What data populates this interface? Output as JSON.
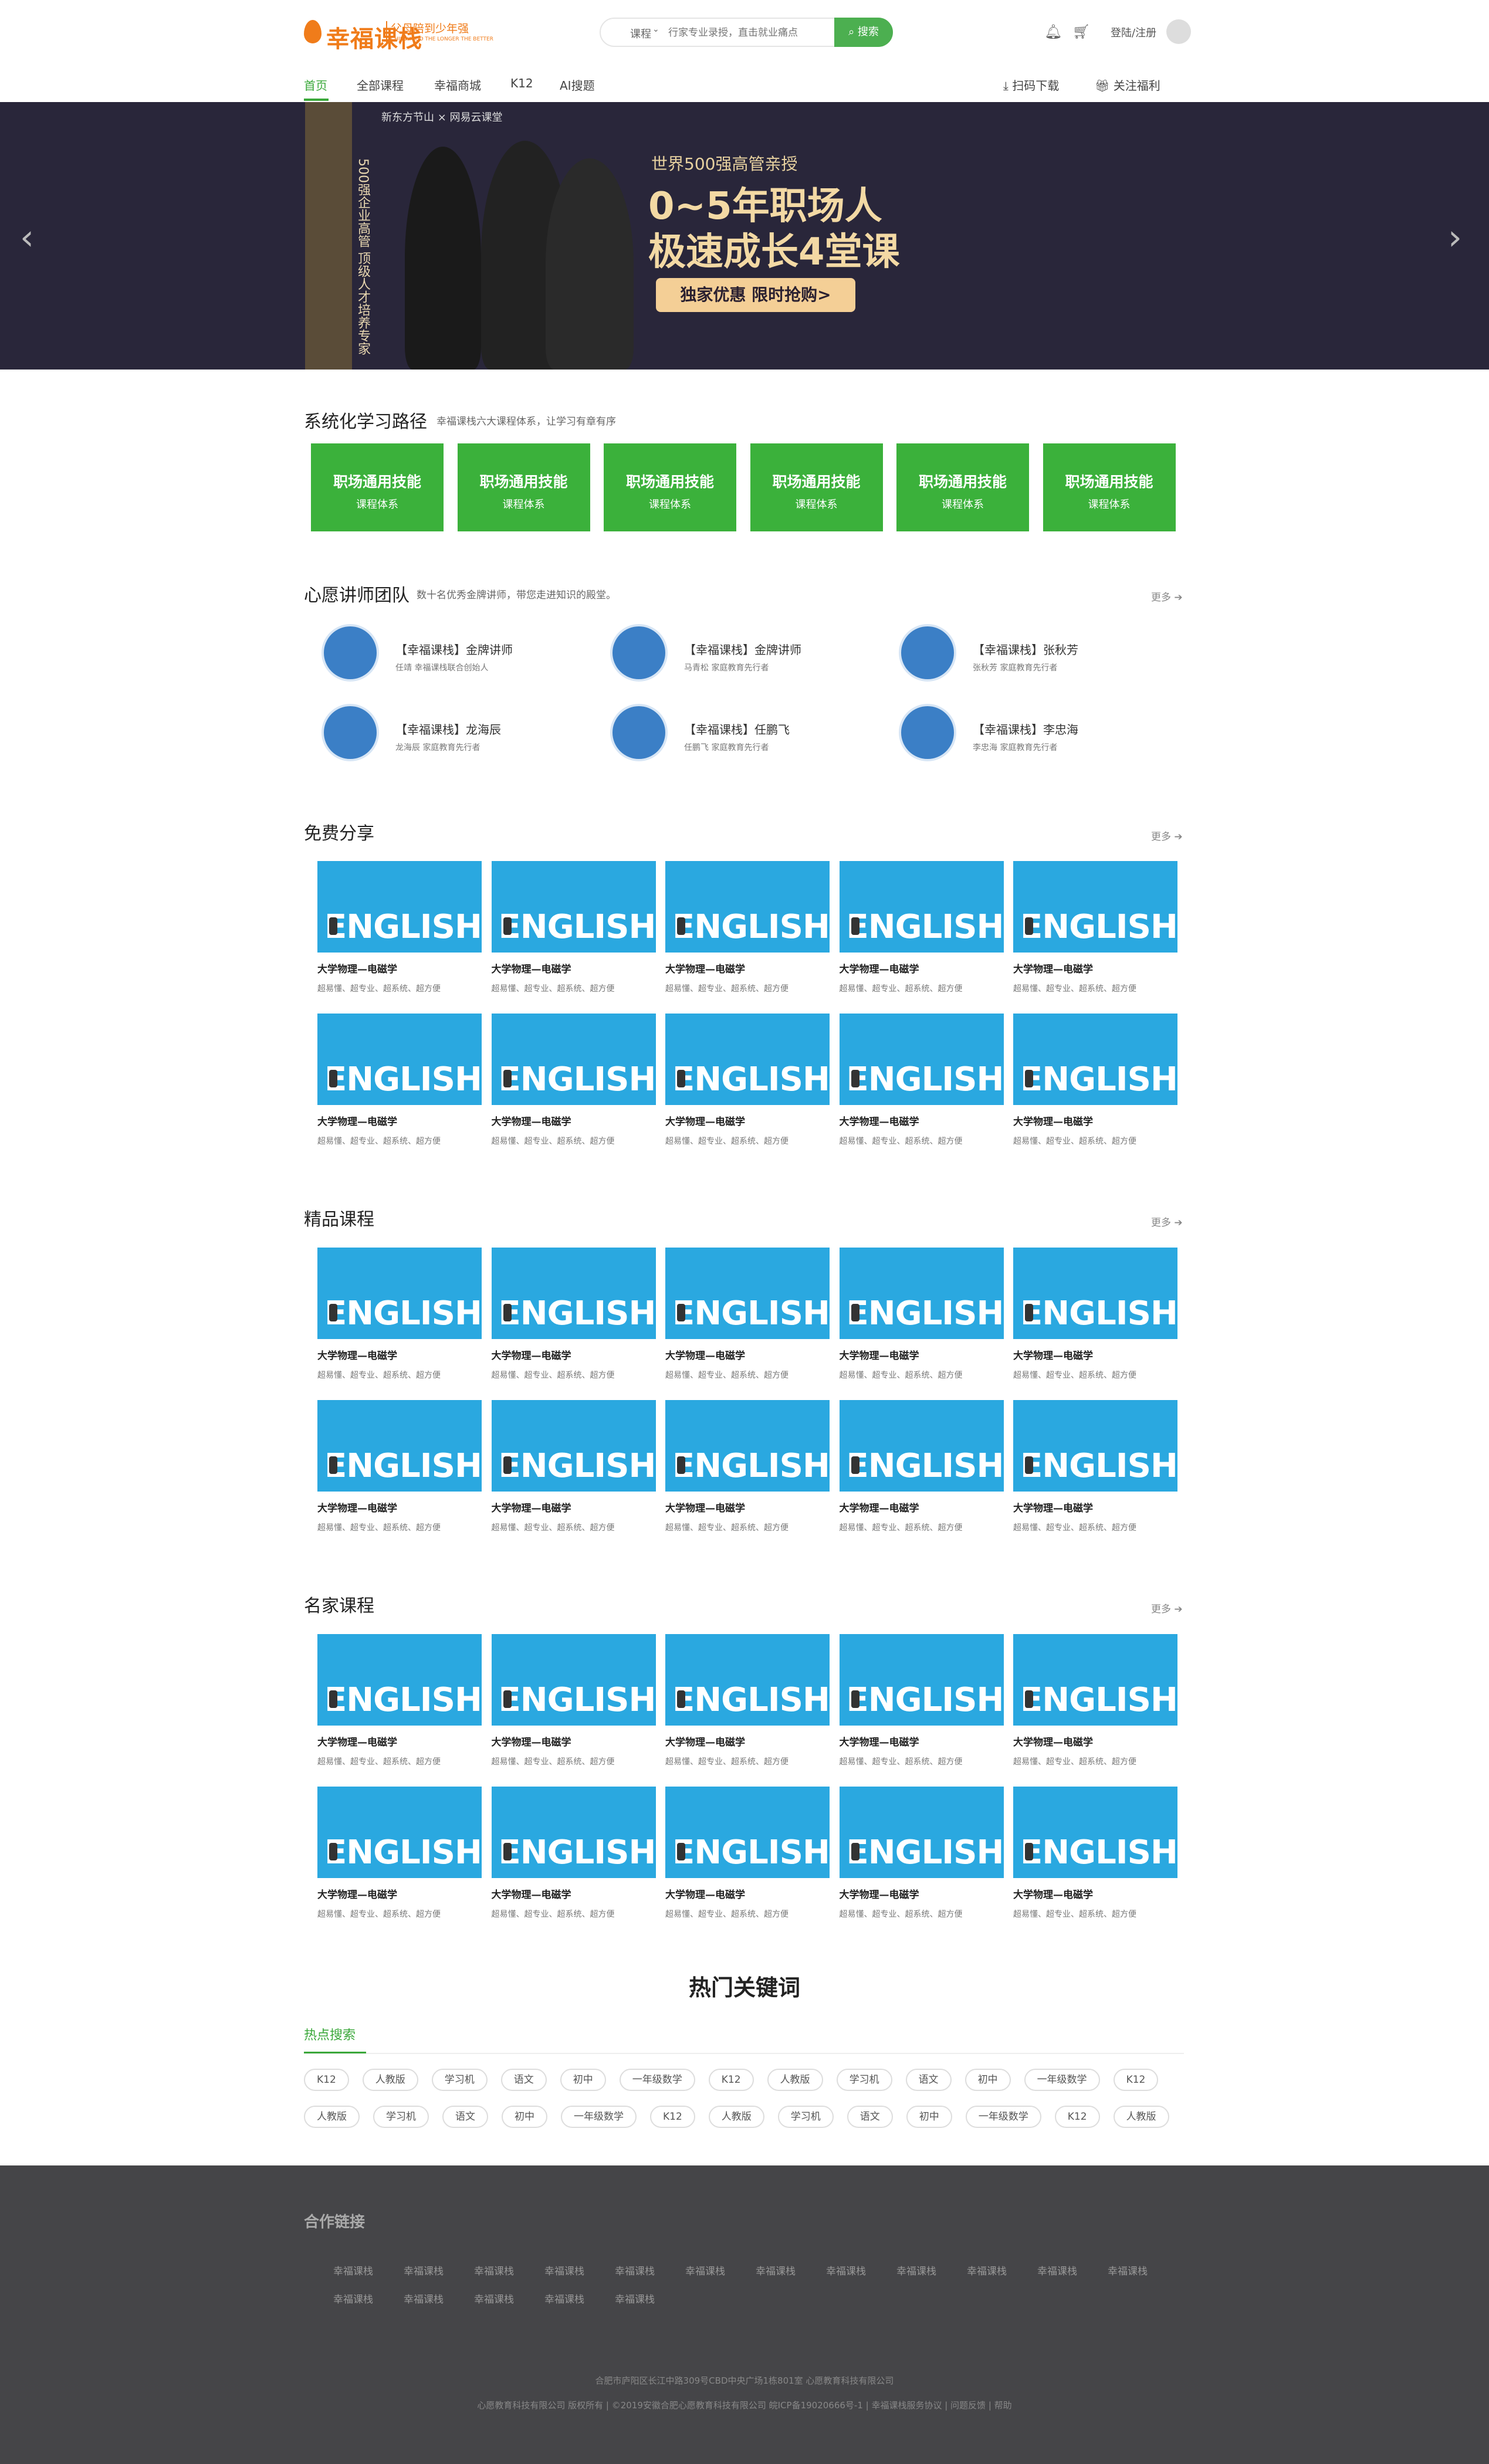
{
  "header": {
    "logo_text": "幸福课栈",
    "logo_sub": "父母陪到少年强",
    "logo_sub2": "CHILDHOOD THE LONGER THE BETTER",
    "search_type": "课程",
    "search_placeholder": "行家专业录授，直击就业痛点",
    "search_button": "搜索",
    "login": "登陆/注册"
  },
  "nav": {
    "items": [
      "首页",
      "全部课程",
      "幸福商城",
      "K12",
      "AI搜题"
    ],
    "scan_download": "扫码下载",
    "follow_benefit": "关注福利"
  },
  "banner": {
    "brand": "新东方节山 × 网易云课堂",
    "side_text": "500强企业高管 顶级人才培养专家",
    "small": "世界500强高管亲授",
    "big1": "0~5年职场人",
    "big2": "极速成长4堂课",
    "cta": "独家优惠 限时抢购>"
  },
  "learning_path": {
    "title": "系统化学习路径",
    "subtitle": "幸福课栈六大课程体系，让学习有章有序",
    "cards": [
      {
        "title": "职场通用技能",
        "sub": "课程体系"
      },
      {
        "title": "职场通用技能",
        "sub": "课程体系"
      },
      {
        "title": "职场通用技能",
        "sub": "课程体系"
      },
      {
        "title": "职场通用技能",
        "sub": "课程体系"
      },
      {
        "title": "职场通用技能",
        "sub": "课程体系"
      },
      {
        "title": "职场通用技能",
        "sub": "课程体系"
      }
    ]
  },
  "teachers": {
    "title": "心愿讲师团队",
    "subtitle": "数十名优秀金牌讲师，带您走进知识的殿堂。",
    "more": "更多",
    "list": [
      {
        "name": "【幸福课栈】金牌讲师",
        "desc": "任靖 幸福课栈联合创始人"
      },
      {
        "name": "【幸福课栈】金牌讲师",
        "desc": "马青松 家庭教育先行者"
      },
      {
        "name": "【幸福课栈】张秋芳",
        "desc": "张秋芳 家庭教育先行者"
      },
      {
        "name": "【幸福课栈】龙海辰",
        "desc": "龙海辰 家庭教育先行者"
      },
      {
        "name": "【幸福课栈】任鹏飞",
        "desc": "任鹏飞 家庭教育先行者"
      },
      {
        "name": "【幸福课栈】李忠海",
        "desc": "李忠海 家庭教育先行者"
      }
    ]
  },
  "course_common": {
    "thumb_text": "ENGLISH",
    "title": "大学物理—电磁学",
    "desc": "超易懂、超专业、超系统、超方便"
  },
  "free_share": {
    "title": "免费分享",
    "more": "更多"
  },
  "premium": {
    "title": "精品课程",
    "more": "更多"
  },
  "famous": {
    "title": "名家课程",
    "more": "更多"
  },
  "keywords": {
    "title": "热门关键词",
    "tab": "热点搜索",
    "row1": [
      "K12",
      "人教版",
      "学习机",
      "语文",
      "初中",
      "一年级数学",
      "K12",
      "人教版",
      "学习机",
      "语文",
      "初中",
      "一年级数学",
      "K12"
    ],
    "row2": [
      "人教版",
      "学习机",
      "语文",
      "初中",
      "一年级数学",
      "K12",
      "人教版",
      "学习机",
      "语文",
      "初中",
      "一年级数学",
      "K12",
      "人教版"
    ]
  },
  "footer": {
    "title": "合作链接",
    "links_row1": [
      "幸福课栈",
      "幸福课栈",
      "幸福课栈",
      "幸福课栈",
      "幸福课栈",
      "幸福课栈",
      "幸福课栈",
      "幸福课栈",
      "幸福课栈",
      "幸福课栈",
      "幸福课栈",
      "幸福课栈"
    ],
    "links_row2": [
      "幸福课栈",
      "幸福课栈",
      "幸福课栈",
      "幸福课栈",
      "幸福课栈"
    ],
    "address": "合肥市庐阳区长江中路309号CBD中央广场1栋801室 心愿教育科技有限公司",
    "copyright": "心愿教育科技有限公司 版权所有 | ©2019安徽合肥心愿教育科技有限公司 皖ICP备19020666号-1 | 幸福课栈服务协议 | 问题反馈 | 帮助"
  }
}
